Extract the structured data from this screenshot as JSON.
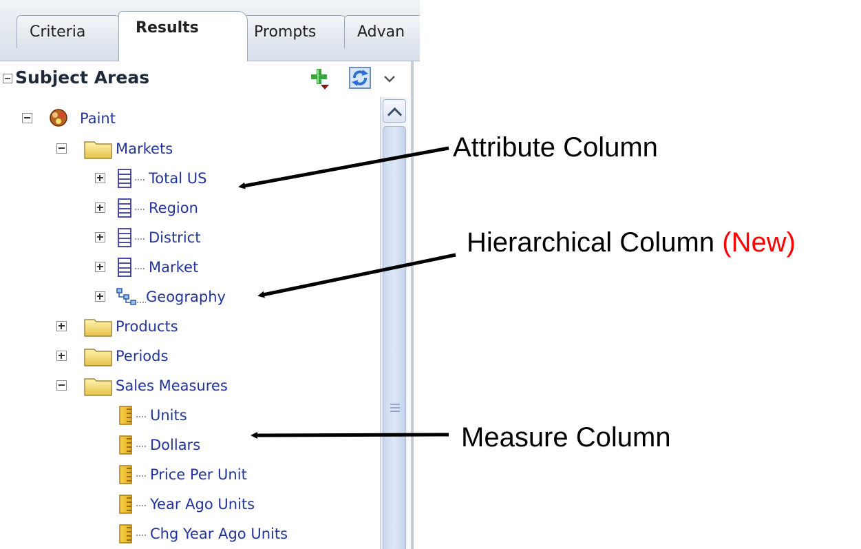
{
  "tabs": [
    {
      "label": "Criteria"
    },
    {
      "label": "Results",
      "active": true
    },
    {
      "label": "Prompts"
    },
    {
      "label": "Advan"
    }
  ],
  "subject_areas": {
    "title": "Subject Areas",
    "icons": [
      "add-icon",
      "refresh-icon",
      "chevron-down-icon"
    ]
  },
  "tree": {
    "root": "Paint",
    "folders": {
      "markets": "Markets",
      "products": "Products",
      "periods": "Periods",
      "sales_measures": "Sales Measures"
    },
    "markets_columns": [
      "Total US",
      "Region",
      "District",
      "Market",
      "Geography"
    ],
    "measure_columns": [
      "Units",
      "Dollars",
      "Price Per Unit",
      "Year Ago Units",
      "Chg Year Ago Units"
    ]
  },
  "annotations": {
    "attribute": "Attribute Column",
    "hierarchical": "Hierarchical Column",
    "new_tag": "(New)",
    "measure": "Measure Column"
  },
  "colors": {
    "tree_text": "#22339a",
    "new_tag": "#ff0000",
    "folder": "#f2d465"
  }
}
